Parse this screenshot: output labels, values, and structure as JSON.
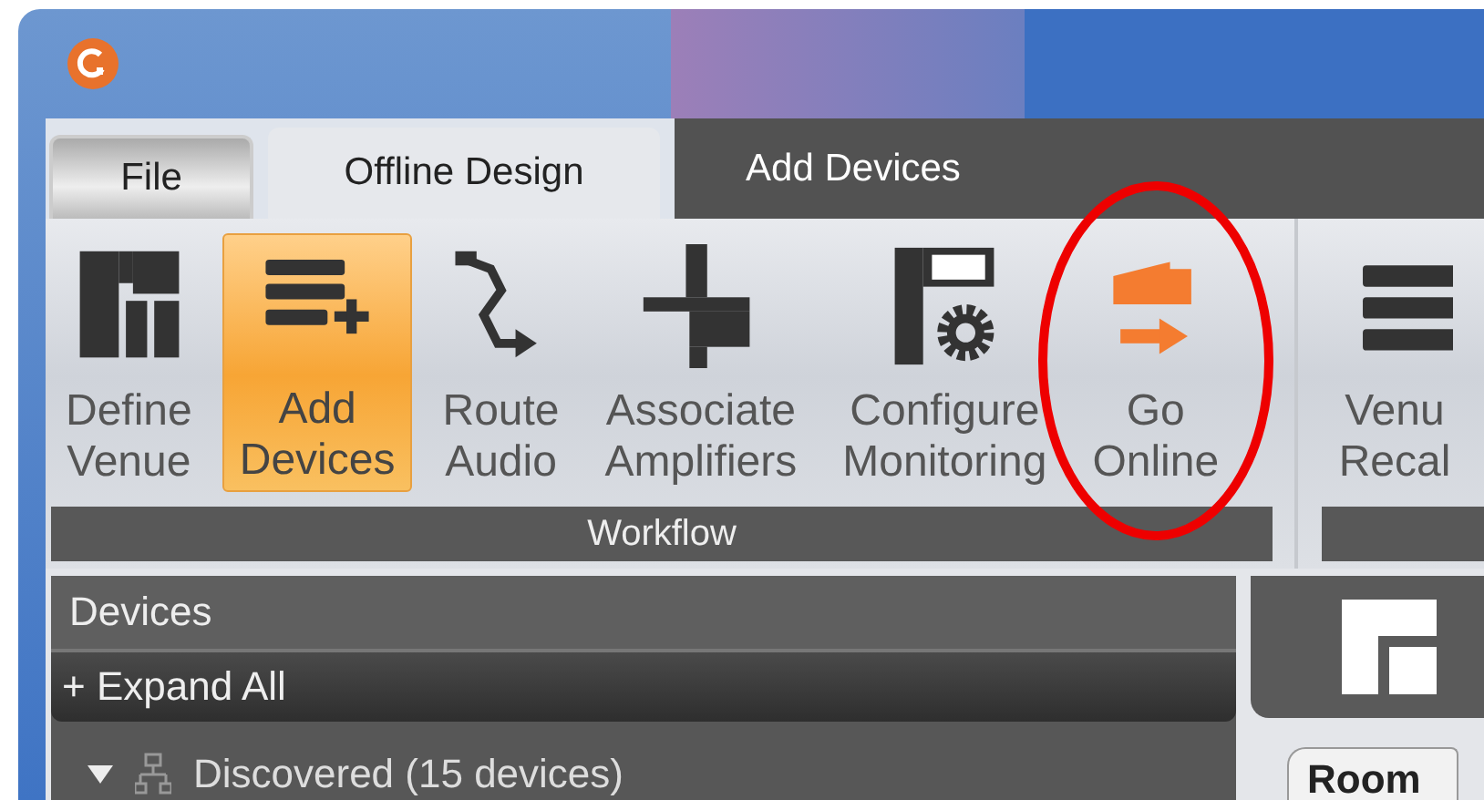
{
  "tabs": [
    {
      "label": "File",
      "kind": "file",
      "selected": false
    },
    {
      "label": "Offline Design",
      "kind": "tab",
      "selected": true
    },
    {
      "label": "Add Devices",
      "kind": "tab",
      "selected": false
    }
  ],
  "ribbon": {
    "groups": [
      {
        "label": "Workflow",
        "buttons": [
          {
            "kind": "venue",
            "label": "Define\nVenue",
            "selected": false,
            "circled": false
          },
          {
            "kind": "add",
            "label": "Add\nDevices",
            "selected": true,
            "circled": false
          },
          {
            "kind": "route",
            "label": "Route\nAudio",
            "selected": false,
            "circled": false
          },
          {
            "kind": "amp",
            "label": "Associate\nAmplifiers",
            "selected": false,
            "circled": false
          },
          {
            "kind": "monitor",
            "label": "Configure\nMonitoring",
            "selected": false,
            "circled": false
          },
          {
            "kind": "online",
            "label": "Go\nOnline",
            "selected": false,
            "circled": true
          }
        ]
      },
      {
        "buttons": [
          {
            "kind": "recall",
            "label": "Venu\nRecal",
            "selected": false,
            "circled": false
          }
        ]
      }
    ]
  },
  "devices_panel": {
    "title": "Devices",
    "expand_all": "+ Expand All",
    "tree": [
      {
        "label": "Discovered (15 devices)",
        "expanded": true
      }
    ]
  },
  "view_tabs": [
    {
      "label": "Room"
    }
  ]
}
